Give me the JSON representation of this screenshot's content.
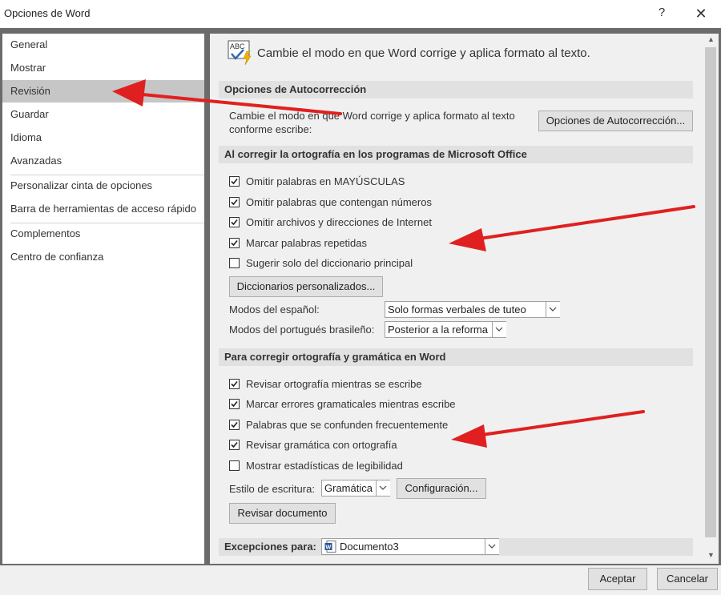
{
  "window": {
    "title": "Opciones de Word",
    "help_glyph": "?",
    "close_glyph": "✕"
  },
  "sidebar": {
    "items": [
      {
        "label": "General"
      },
      {
        "label": "Mostrar"
      },
      {
        "label": "Revisión",
        "selected": true
      },
      {
        "label": "Guardar"
      },
      {
        "label": "Idioma"
      },
      {
        "label": "Avanzadas"
      },
      {
        "label": "Personalizar cinta de opciones"
      },
      {
        "label": "Barra de herramientas de acceso rápido"
      },
      {
        "label": "Complementos"
      },
      {
        "label": "Centro de confianza"
      }
    ]
  },
  "main": {
    "heading": "Cambie el modo en que Word corrige y aplica formato al texto.",
    "icon": "abc-spellcheck-icon",
    "autocorrect": {
      "title": "Opciones de Autocorrección",
      "description_line1": "Cambie el modo en que Word corrige y aplica formato al texto",
      "description_line2": "conforme escribe:",
      "button": "Opciones de Autocorrección..."
    },
    "office_spelling": {
      "title": "Al corregir la ortografía en los programas de Microsoft Office",
      "options": [
        {
          "label": "Omitir palabras en MAYÚSCULAS",
          "checked": true
        },
        {
          "label": "Omitir palabras que contengan números",
          "checked": true
        },
        {
          "label": "Omitir archivos y direcciones de Internet",
          "checked": true
        },
        {
          "label": "Marcar palabras repetidas",
          "checked": true
        },
        {
          "label": "Sugerir solo del diccionario principal",
          "checked": false
        }
      ],
      "custom_dictionaries_button": "Diccionarios personalizados...",
      "spanish_modes_label": "Modos del español:",
      "spanish_modes_value": "Solo formas verbales de tuteo",
      "portuguese_modes_label": "Modos del portugués brasileño:",
      "portuguese_modes_value": "Posterior a la reforma"
    },
    "word_grammar": {
      "title": "Para corregir ortografía y gramática en Word",
      "options": [
        {
          "label": "Revisar ortografía mientras se escribe",
          "checked": true
        },
        {
          "label": "Marcar errores gramaticales mientras escribe",
          "checked": true
        },
        {
          "label": "Palabras que se confunden frecuentemente",
          "checked": true
        },
        {
          "label": "Revisar gramática con ortografía",
          "checked": true
        },
        {
          "label": "Mostrar estadísticas de legibilidad",
          "checked": false
        }
      ],
      "writing_style_label": "Estilo de escritura:",
      "writing_style_value": "Gramática",
      "settings_button": "Configuración...",
      "check_document_button": "Revisar documento"
    },
    "exceptions": {
      "label": "Excepciones para:",
      "document": "Documento3"
    }
  },
  "footer": {
    "ok": "Aceptar",
    "cancel": "Cancelar"
  },
  "colors": {
    "annotation_arrow": "#e02020",
    "frame": "#6b6b6b",
    "selected_nav": "#c6c6c6",
    "section_bar": "#e1e1e1"
  }
}
